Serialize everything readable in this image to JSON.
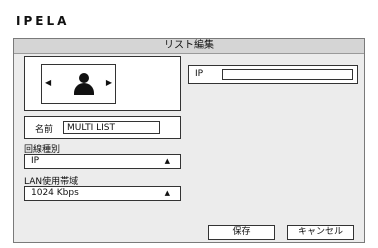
{
  "brand": "IPELA",
  "dialog": {
    "title": "リスト編集",
    "name_label": "名前",
    "name_value": "MULTI LIST",
    "line_type_label": "回線種別",
    "line_type_value": "IP",
    "bandwidth_label": "LAN使用帯域",
    "bandwidth_value": "1024 Kbps",
    "ip_label": "IP",
    "ip_value": "",
    "save_label": "保存",
    "cancel_label": "キャンセル"
  }
}
